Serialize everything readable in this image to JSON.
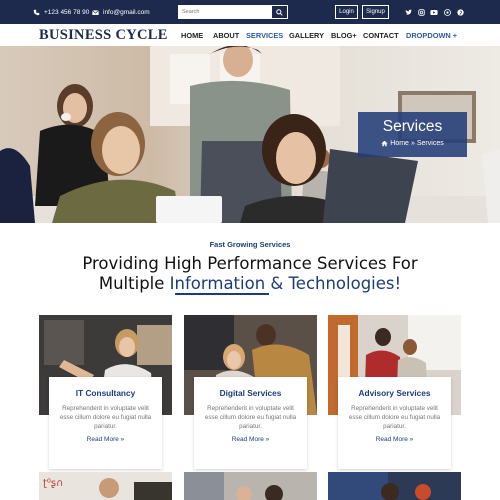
{
  "topbar": {
    "phone": "+123 456 78 90",
    "email": "info@gmail.com",
    "search_placeholder": "Search",
    "login_label": "Login",
    "signup_label": "Signup",
    "social_icons": [
      "twitter-icon",
      "instagram-icon",
      "youtube-icon",
      "behance-icon",
      "pinterest-icon"
    ]
  },
  "nav": {
    "logo": "BUSINESS CYCLE",
    "items": [
      "HOME",
      "ABOUT",
      "SERVICES",
      "GALLERY",
      "BLOG+",
      "CONTACT",
      "DROPDOWN +"
    ],
    "active": "SERVICES"
  },
  "hero": {
    "title": "Services",
    "crumb_home": "Home",
    "crumb_sep": "»",
    "crumb_current": "Services"
  },
  "intro": {
    "tagline": "Fast Growing Services",
    "headline_line1": "Providing High Performance Services For",
    "headline_line2_plain": "Multiple ",
    "headline_line2_highlight": "Information & Technologies!"
  },
  "services": [
    {
      "title": "IT Consultancy",
      "text": "Reprehenderit in voluptate velit esse cillum dolore eu fugiat nulla pariatur.",
      "link": "Read More »"
    },
    {
      "title": "Digital Services",
      "text": "Reprehenderit in voluptate velit esse cillum dolore eu fugiat nulla pariatur.",
      "link": "Read More »"
    },
    {
      "title": "Advisory Services",
      "text": "Reprehenderit in voluptate velit esse cillum dolore eu fugiat nulla pariatur.",
      "link": "Read More »"
    }
  ],
  "colors": {
    "navy": "#1d2a4d",
    "accent": "#1d3b7a",
    "active_link": "#2f5aa0",
    "hero_box": "#243e78"
  }
}
